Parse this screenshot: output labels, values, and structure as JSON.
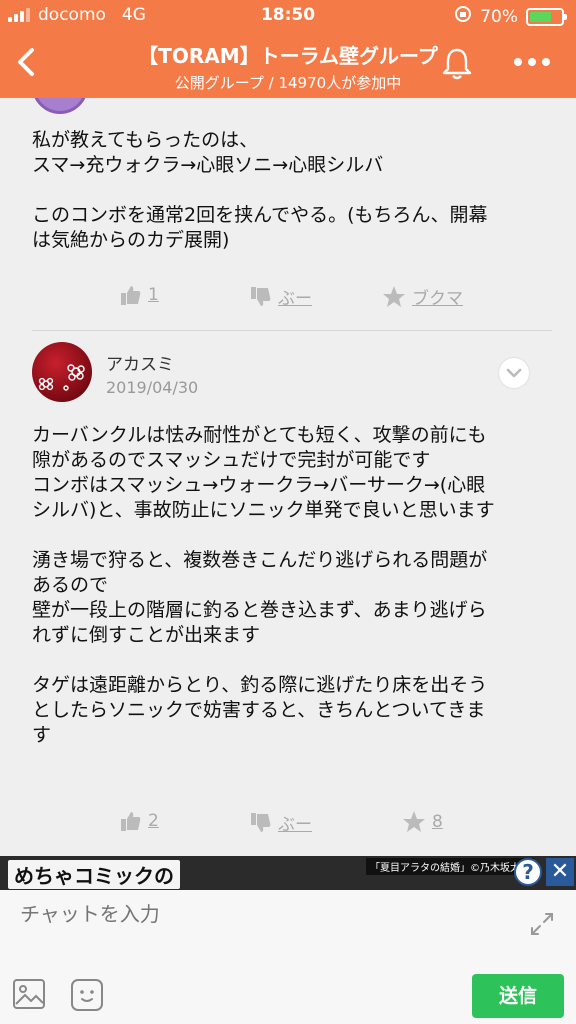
{
  "status": {
    "carrier": "docomo",
    "network": "4G",
    "time": "18:50",
    "battery": "70%",
    "battery_level": 0.7
  },
  "header": {
    "title": "【TORAM】トーラム壁グループ",
    "subtitle": "公開グループ / 14970人が参加中"
  },
  "posts": [
    {
      "author": "",
      "text": "私が教えてもらったのは、\nスマ→充ウォクラ→心眼ソニ→心眼シルバ\n\nこのコンボを通常2回を挟んでやる。(もちろん、開幕\nは気絶からのカデ展開)",
      "likes": "1",
      "boo": "ぶー",
      "bookmark": "ブクマ"
    },
    {
      "author": "アカスミ",
      "date": "2019/04/30",
      "text": "カーバンクルは怯み耐性がとても短く、攻撃の前にも\n隙があるのでスマッシュだけで完封が可能です\nコンボはスマッシュ→ウォークラ→バーサーク→(心眼\nシルバ)と、事故防止にソニック単発で良いと思います\n\n湧き場で狩ると、複数巻きこんだり逃げられる問題が\nあるので\n壁が一段上の階層に釣ると巻き込まず、あまり逃げら\nれずに倒すことが出来ます\n\nタゲは遠距離からとり、釣る際に逃げたり床を出そう\nとしたらソニックで妨害すると、きちんとついてきま\nす",
      "likes": "2",
      "boo": "ぶー",
      "bookmarks": "8"
    }
  ],
  "ad": {
    "title": "めちゃコミックの",
    "tag": "「夏目アラタの結婚」©乃木坂太郎",
    "help": "?",
    "close": "✕"
  },
  "composer": {
    "placeholder": "チャットを入力",
    "send_label": "送信"
  },
  "colors": {
    "header": "#f47b48",
    "send": "#2ec35a",
    "background": "#efefef"
  }
}
